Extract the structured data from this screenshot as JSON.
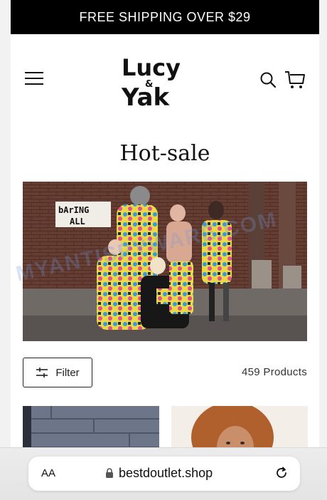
{
  "announcement": {
    "text": "FREE SHIPPING OVER $29"
  },
  "header": {
    "logo": {
      "line1": "Lucy",
      "amp": "&",
      "line2": "Yak"
    }
  },
  "page_title": "Hot-sale",
  "hero": {
    "sign_line1": "bArING",
    "sign_line2": "ALL"
  },
  "filter": {
    "label": "Filter"
  },
  "product_count": "459 Products",
  "watermark": "MYANTISPYWARE.COM",
  "browser": {
    "aa_label": "AA",
    "url": "bestdoutlet.shop"
  },
  "colors": {
    "announcement_bg": "#000000",
    "text": "#111111"
  }
}
